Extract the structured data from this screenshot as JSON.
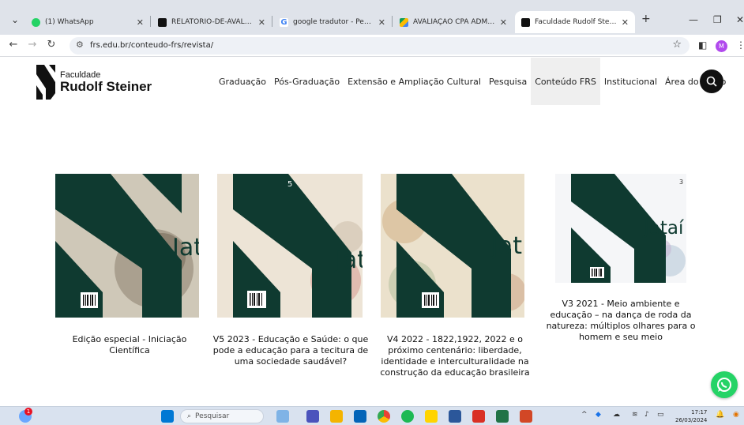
{
  "browser": {
    "tabs": [
      {
        "title": "(1) WhatsApp",
        "favicon_color": "#25d366"
      },
      {
        "title": "RELATORIO-DE-AVALIACAO",
        "favicon_color": "#111111"
      },
      {
        "title": "google tradutor - Pesquisa",
        "favicon_color": "#4285f4"
      },
      {
        "title": "AVALIAÇÃO CPA ADMINIST",
        "favicon_color": "#1a73e8"
      },
      {
        "title": "Faculdade Rudolf Steiner",
        "favicon_color": "#111111"
      }
    ],
    "url": "frs.edu.br/conteudo-frs/revista/",
    "profile_initial": "M"
  },
  "site": {
    "logo_small": "Faculdade",
    "logo_big": "Rudolf Steiner",
    "nav": [
      {
        "label": "Graduação"
      },
      {
        "label": "Pós-Graduação"
      },
      {
        "label": "Extensão e Ampliação Cultural"
      },
      {
        "label": "Pesquisa"
      },
      {
        "label": "Conteúdo FRS"
      },
      {
        "label": "Institucional"
      },
      {
        "label": "Área do Aluno"
      }
    ],
    "active_nav": "Conteúdo FRS",
    "brand_color": "#0f3a30"
  },
  "magazines": [
    {
      "cover_word": "Jat",
      "caption": "Edição especial - Iniciação Científica"
    },
    {
      "cover_word": "Jat",
      "number": "5",
      "caption": "V5 2023 - Educação e Saúde: o que pode a educação para a tecitura de uma sociedade saudável?"
    },
    {
      "cover_word": "Jat",
      "caption": "V4 2022 - 1822,1922, 2022 e o próximo centenário: liberdade, identidade e interculturalidade na construção da educação brasileira"
    },
    {
      "cover_word": "Jataí",
      "number": "3",
      "caption": "V3 2021 - Meio ambiente e educação – na dança de roda da natureza: múltiplos olhares para o homem e seu meio"
    }
  ],
  "taskbar": {
    "search_placeholder": "Pesquisar",
    "time": "17:17",
    "date": "26/03/2024",
    "notification_count": "1"
  }
}
